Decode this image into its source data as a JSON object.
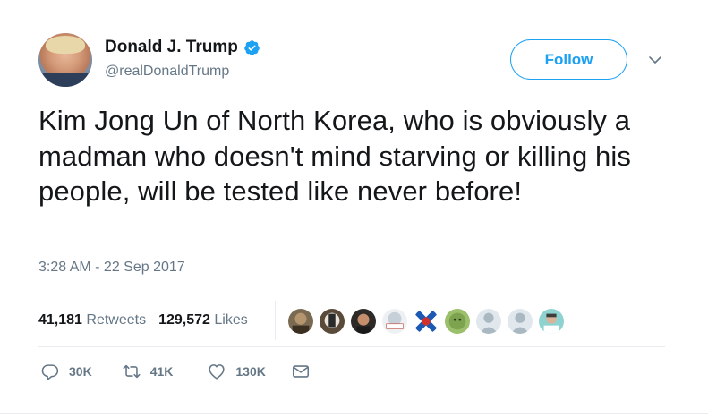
{
  "author": {
    "name": "Donald J. Trump",
    "handle": "@realDonaldTrump",
    "verified": true
  },
  "follow_button": {
    "label": "Follow"
  },
  "tweet": {
    "text": "Kim Jong Un of North Korea, who is obviously a madman who doesn't mind starving or killing his people, will be tested like never before!",
    "timestamp": "3:28 AM - 22 Sep 2017"
  },
  "stats": {
    "retweets_count": "41,181",
    "retweets_label": "Retweets",
    "likes_count": "129,572",
    "likes_label": "Likes"
  },
  "likers": [
    "liker-avatar",
    "liker-avatar",
    "liker-avatar",
    "liker-avatar",
    "liker-avatar",
    "liker-avatar",
    "liker-avatar",
    "liker-avatar",
    "liker-avatar"
  ],
  "actions": {
    "reply_count": "30K",
    "retweet_count": "41K",
    "like_count": "130K"
  },
  "colors": {
    "accent": "#1da1f2",
    "secondary_text": "#657786",
    "divider": "#e6ecf0"
  },
  "icons": [
    "verified-badge-icon",
    "chevron-down-icon",
    "reply-icon",
    "retweet-icon",
    "heart-icon",
    "message-icon"
  ]
}
